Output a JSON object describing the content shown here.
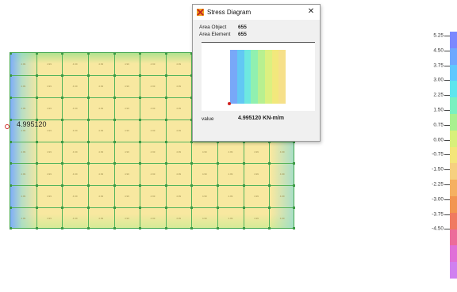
{
  "plate": {
    "cell_label": "4.99",
    "value_readout": "4.995120"
  },
  "dialog": {
    "title": "Stress Diagram",
    "area_object_label": "Area Object",
    "area_object_value": "655",
    "area_element_label": "Area Element",
    "area_element_value": "655",
    "value_label": "value",
    "value_text": "4.995120  KN-m/m",
    "close_glyph": "✕",
    "app_icon": "app-icon"
  },
  "legend": {
    "labels": [
      "5.25",
      "4.50",
      "3.75",
      "3.00",
      "2.25",
      "1.50",
      "0.75",
      "0.00",
      "-0.75",
      "-1.50",
      "-2.25",
      "-3.00",
      "-3.75",
      "-4.50"
    ],
    "colors": [
      "#7a88ff",
      "#6ea8ff",
      "#5ec8ff",
      "#5ee6ee",
      "#7af0c0",
      "#a8f090",
      "#d8f07a",
      "#f4e67a",
      "#f6d080",
      "#f5b060",
      "#f29550",
      "#f07a60",
      "#ec6c9a",
      "#e070d8",
      "#d080f0"
    ]
  }
}
